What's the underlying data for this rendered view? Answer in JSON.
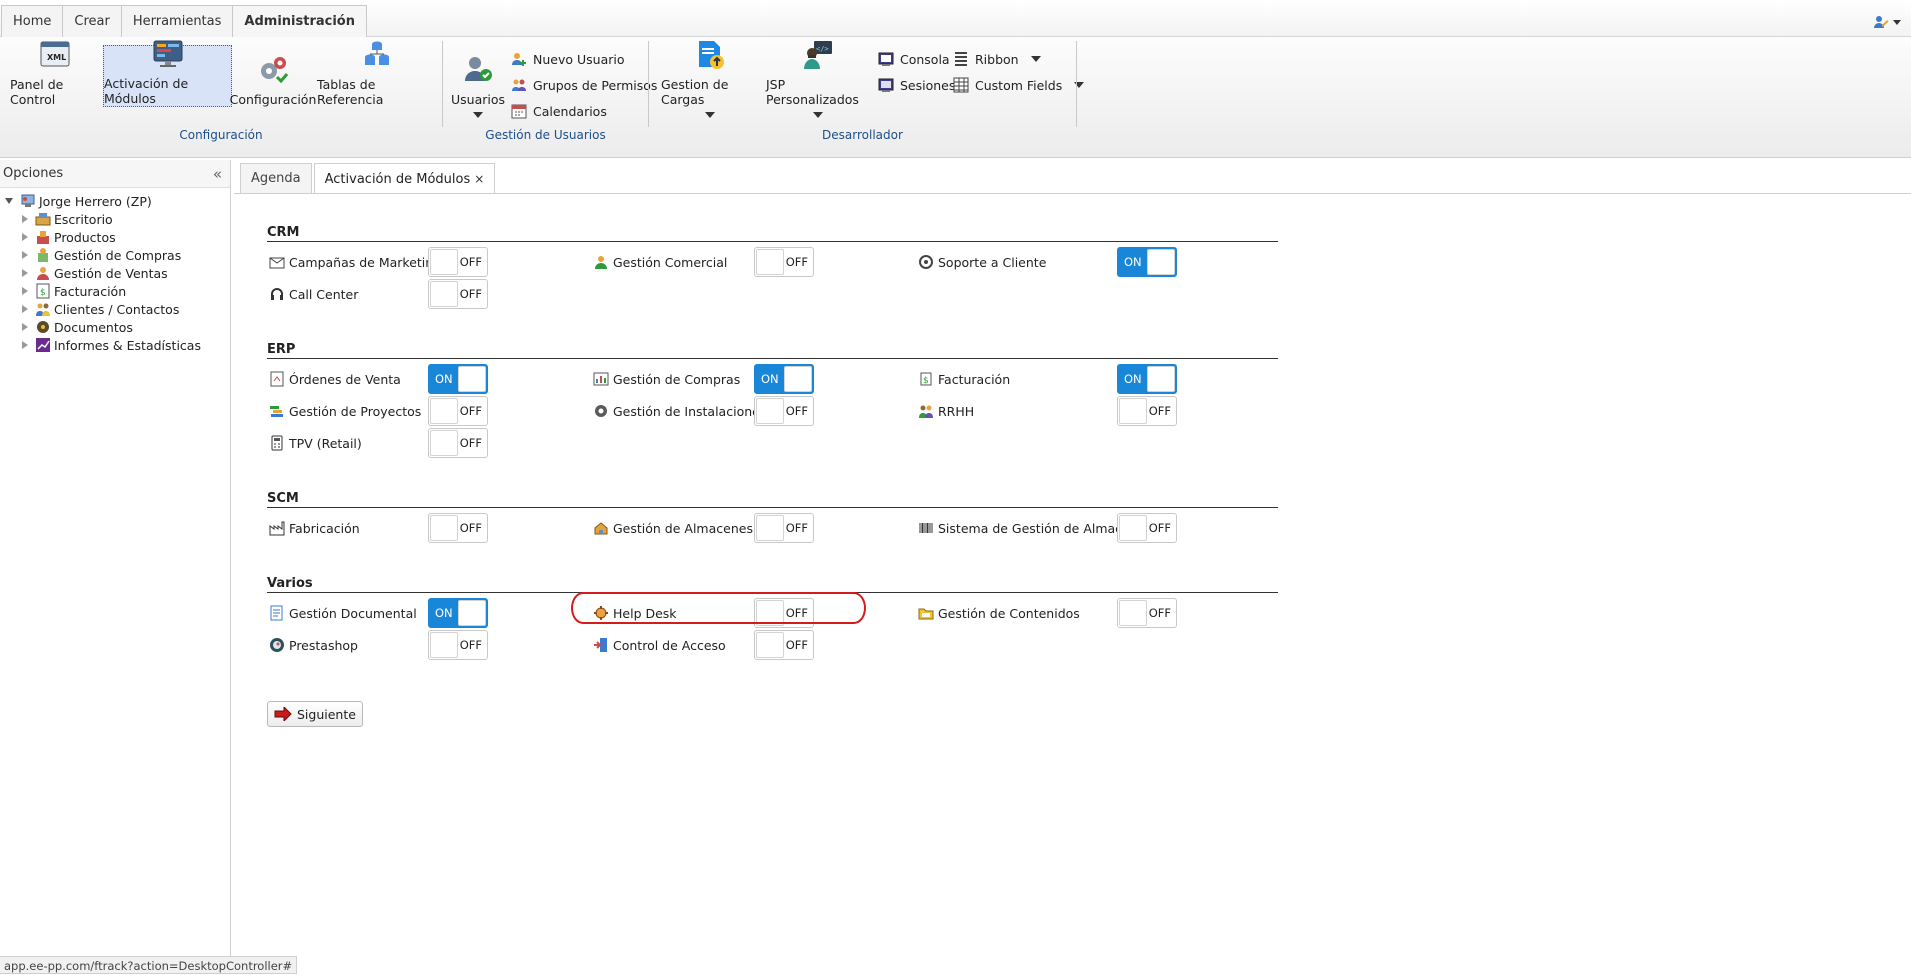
{
  "topbar": {
    "tabs": [
      "Home",
      "Crear",
      "Herramientas",
      "Administración"
    ],
    "active_tab": "Administración"
  },
  "ribbon": {
    "configuracion": {
      "label": "Configuración",
      "buttons": [
        "Panel de Control",
        "Activación de Módulos",
        "Configuración",
        "Tablas de Referencia"
      ]
    },
    "usuarios": {
      "label": "Gestión de Usuarios",
      "big": "Usuarios",
      "small": [
        "Nuevo Usuario",
        "Grupos de Permisos",
        "Calendarios"
      ]
    },
    "desarrollador": {
      "label": "Desarrollador",
      "big": [
        "Gestion de Cargas",
        "JSP Personalizados"
      ],
      "small": [
        "Consola",
        "Sesiones",
        "Ribbon",
        "Custom Fields"
      ]
    }
  },
  "sidebar": {
    "title": "Opciones",
    "root": "Jorge Herrero (ZP)",
    "items": [
      "Escritorio",
      "Productos",
      "Gestión de Compras",
      "Gestión de Ventas",
      "Facturación",
      "Clientes / Contactos",
      "Documentos",
      "Informes & Estadísticas"
    ]
  },
  "content": {
    "tabs": [
      "Agenda",
      "Activación de Módulos"
    ],
    "close_glyph": "×",
    "on_text": "ON",
    "off_text": "OFF",
    "sections": [
      {
        "title": "CRM",
        "modules": [
          {
            "name": "Campañas de Marketing",
            "state": false
          },
          {
            "name": "Gestión Comercial",
            "state": false
          },
          {
            "name": "Soporte a Cliente",
            "state": true
          },
          {
            "name": "Call Center",
            "state": false
          }
        ]
      },
      {
        "title": "ERP",
        "modules": [
          {
            "name": "Órdenes de Venta",
            "state": true
          },
          {
            "name": "Gestión de Compras",
            "state": true
          },
          {
            "name": "Facturación",
            "state": true
          },
          {
            "name": "Gestión de Proyectos",
            "state": false
          },
          {
            "name": "Gestión de Instalaciones",
            "state": false
          },
          {
            "name": "RRHH",
            "state": false
          },
          {
            "name": "TPV (Retail)",
            "state": false
          }
        ]
      },
      {
        "title": "SCM",
        "modules": [
          {
            "name": "Fabricación",
            "state": false
          },
          {
            "name": "Gestión de Almacenes",
            "state": false
          },
          {
            "name": "Sistema de Gestión de Almacén",
            "state": false
          }
        ]
      },
      {
        "title": "Varios",
        "modules": [
          {
            "name": "Gestión Documental",
            "state": true
          },
          {
            "name": "Help Desk",
            "state": false
          },
          {
            "name": "Gestión de Contenidos",
            "state": false
          },
          {
            "name": "Prestashop",
            "state": false
          },
          {
            "name": "Control de Acceso",
            "state": false
          }
        ]
      }
    ],
    "next_button": "Siguiente"
  },
  "statusbar": {
    "url": "app.ee-pp.com/ftrack?action=DesktopController#"
  },
  "colors": {
    "accent_on": "#1a86d8",
    "group_label": "#1d4e89",
    "highlight": "#d41c1c"
  }
}
